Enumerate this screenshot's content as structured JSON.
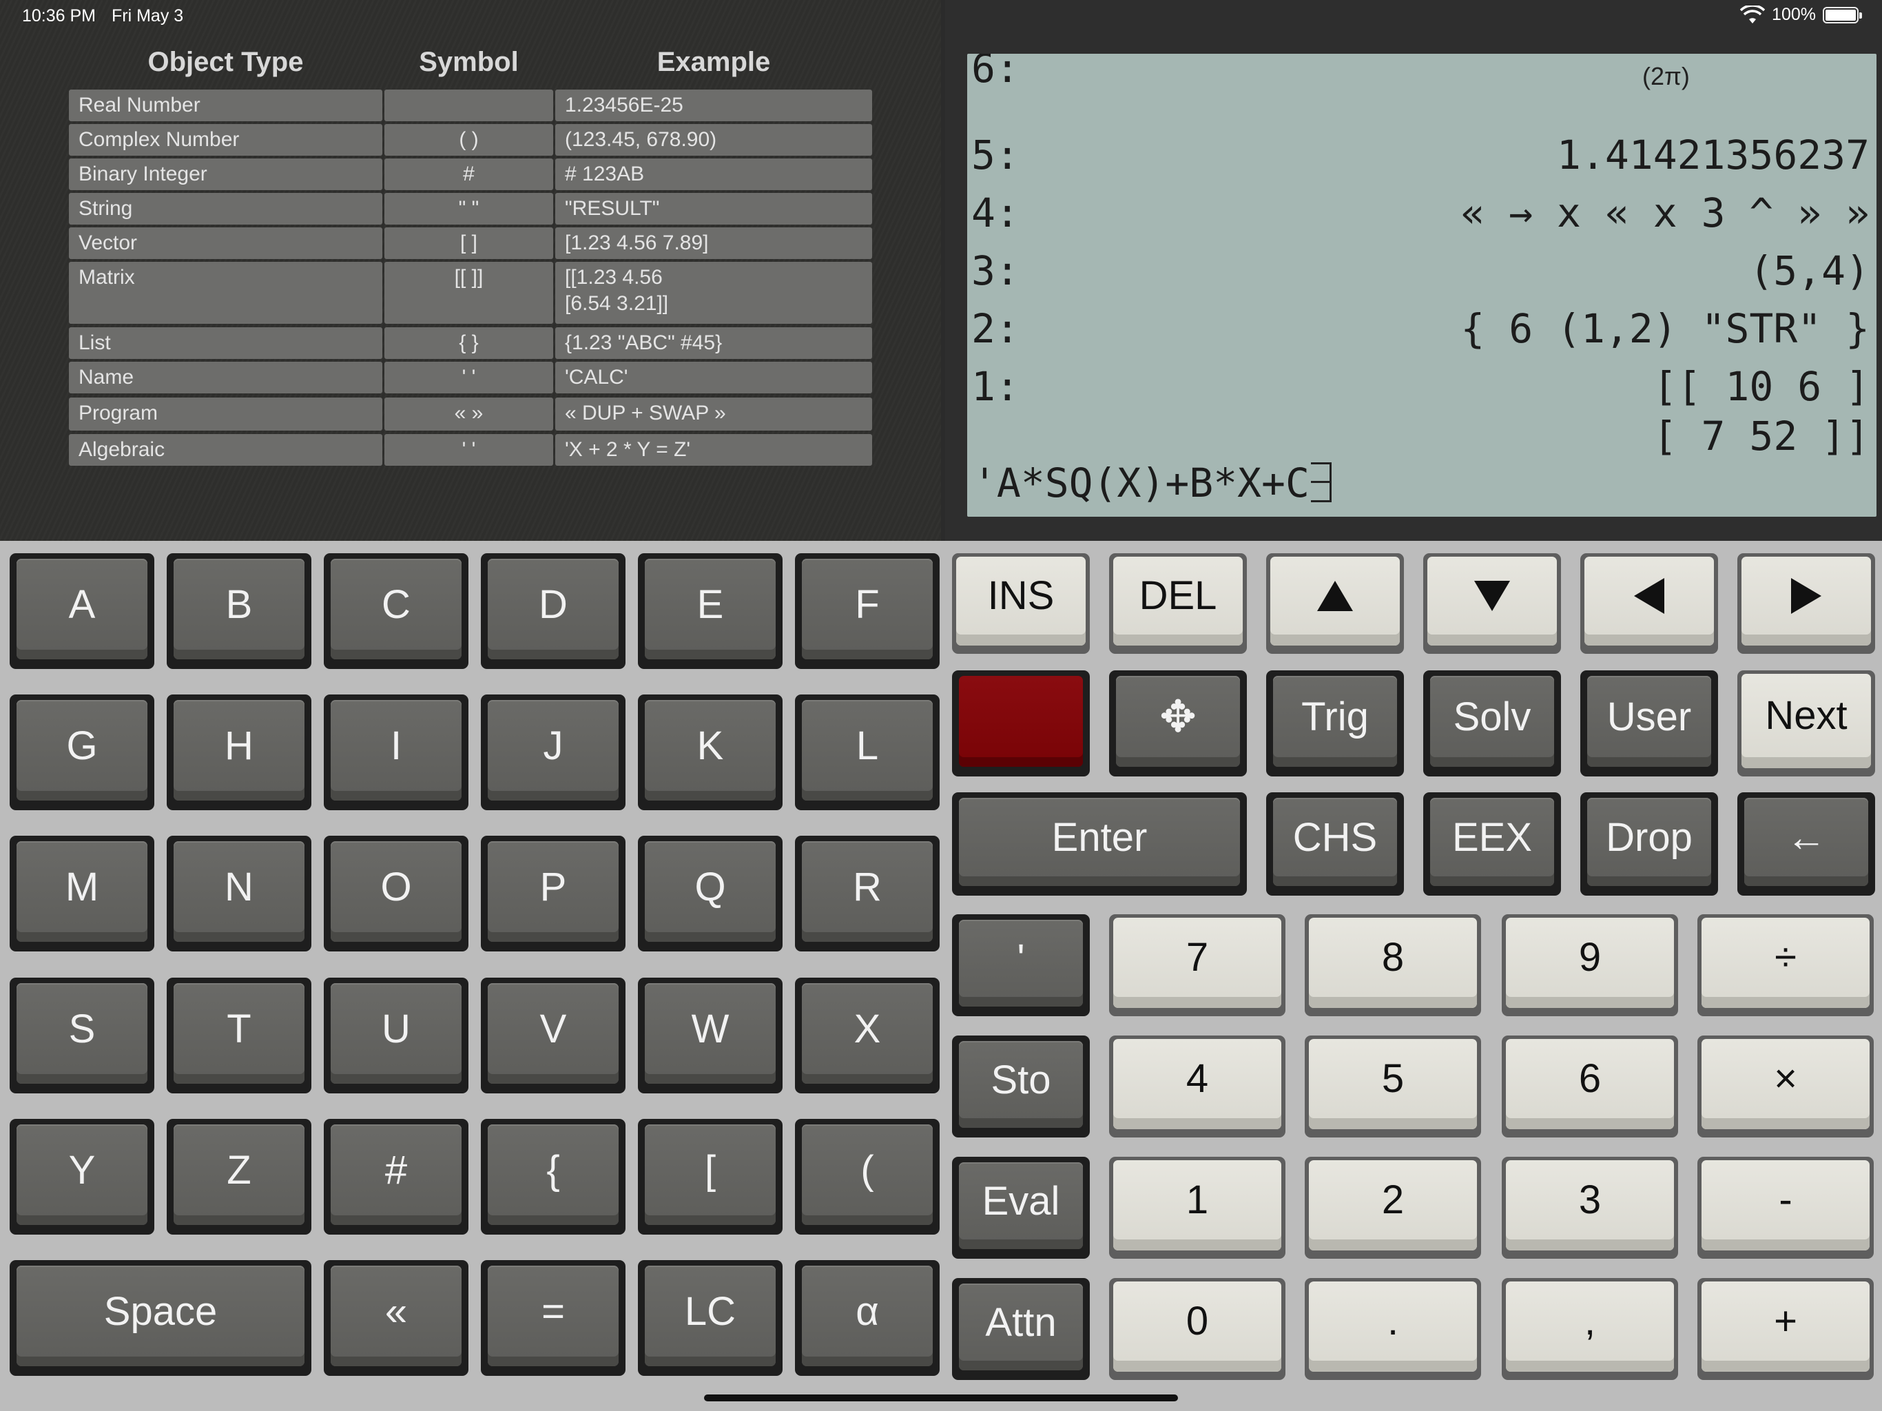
{
  "status_bar": {
    "time": "10:36 PM",
    "date": "Fri May 3",
    "battery": "100%"
  },
  "reference_table": {
    "headers": [
      "Object Type",
      "Symbol",
      "Example"
    ],
    "rows": [
      {
        "type": "Real Number",
        "symbol": "",
        "example": "1.23456E-25"
      },
      {
        "type": "Complex Number",
        "symbol": "( )",
        "example": "(123.45, 678.90)"
      },
      {
        "type": "Binary Integer",
        "symbol": "#",
        "example": "# 123AB"
      },
      {
        "type": "String",
        "symbol": "\" \"",
        "example": "\"RESULT\""
      },
      {
        "type": "Vector",
        "symbol": "[ ]",
        "example": "[1.23 4.56 7.89]"
      },
      {
        "type": "Matrix",
        "symbol": "[[ ]]",
        "example": "[[1.23 4.56\n[6.54 3.21]]"
      },
      {
        "type": "List",
        "symbol": "{ }",
        "example": "{1.23 \"ABC\" #45}"
      },
      {
        "type": "Name",
        "symbol": "' '",
        "example": "'CALC'"
      },
      {
        "type": "Program",
        "symbol": "« »",
        "example": "« DUP + SWAP »"
      },
      {
        "type": "Algebraic",
        "symbol": "' '",
        "example": "'X + 2 * Y = Z'"
      }
    ]
  },
  "display": {
    "title": "(2π)",
    "partial_row": "6:",
    "stack": [
      {
        "level": "5:",
        "value": "1.41421356237"
      },
      {
        "level": "4:",
        "value": "« → x « x 3 ^ » »"
      },
      {
        "level": "3:",
        "value": "(5,4)"
      },
      {
        "level": "2:",
        "value": "{ 6 (1,2) \"STR\" }"
      },
      {
        "level": "1:",
        "value": "[[ 10 6 ]"
      }
    ],
    "stack_continuation": "[ 7 52 ]]",
    "input_line": "'A*SQ(X)+B*X+C"
  },
  "alpha_keys": {
    "row1": [
      "A",
      "B",
      "C",
      "D",
      "E",
      "F"
    ],
    "row2": [
      "G",
      "H",
      "I",
      "J",
      "K",
      "L"
    ],
    "row3": [
      "M",
      "N",
      "O",
      "P",
      "Q",
      "R"
    ],
    "row4": [
      "S",
      "T",
      "U",
      "V",
      "W",
      "X"
    ],
    "row5": [
      "Y",
      "Z",
      "#",
      "{",
      "[",
      "("
    ],
    "row6": [
      "Space",
      "«",
      "=",
      "LC",
      "α"
    ]
  },
  "func_keys": {
    "row1": [
      "INS",
      "DEL"
    ],
    "row2": [
      "Trig",
      "Solv",
      "User",
      "Next"
    ],
    "row3": [
      "Enter",
      "CHS",
      "EEX",
      "Drop",
      "←"
    ]
  },
  "num_keys": {
    "side": [
      "'",
      "Sto",
      "Eval",
      "Attn"
    ],
    "digits": [
      [
        "7",
        "8",
        "9",
        "÷"
      ],
      [
        "4",
        "5",
        "6",
        "×"
      ],
      [
        "1",
        "2",
        "3",
        "-"
      ],
      [
        "0",
        ".",
        ",",
        "+"
      ]
    ]
  },
  "icons": {
    "cursor_pad": "✥",
    "up": "up-arrow-icon",
    "down": "down-arrow-icon",
    "left": "left-arrow-icon",
    "right": "right-arrow-icon"
  },
  "colors": {
    "lcd": "#a5b7b3",
    "shift_key": "#7e0509",
    "dark_key": "#62625f",
    "light_key": "#e2e1da"
  }
}
